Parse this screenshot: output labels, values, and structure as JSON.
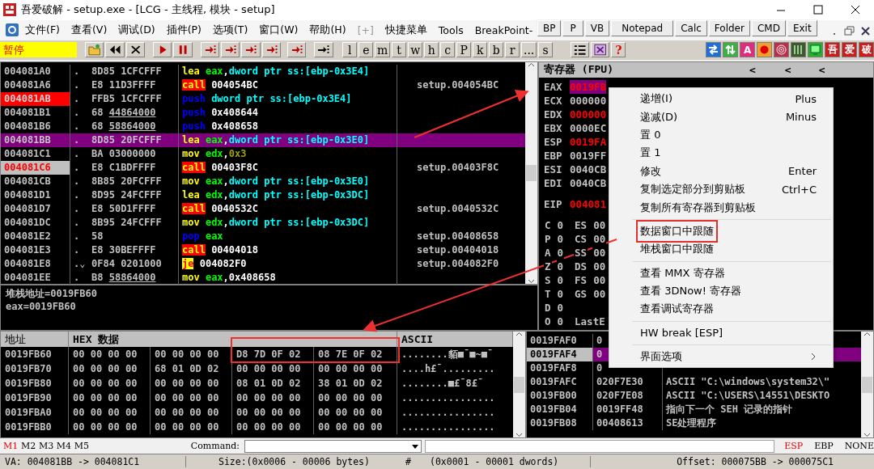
{
  "window": {
    "title": "吾爱破解 - setup.exe - [LCG - 主线程, 模块 - setup]"
  },
  "menu": [
    {
      "label": "文件(F)",
      "disabled": false
    },
    {
      "label": "查看(V)",
      "disabled": false
    },
    {
      "label": "调试(D)",
      "disabled": false
    },
    {
      "label": "插件(P)",
      "disabled": false
    },
    {
      "label": "选项(T)",
      "disabled": false
    },
    {
      "label": "窗口(W)",
      "disabled": false
    },
    {
      "label": "帮助(H)",
      "disabled": false
    },
    {
      "label": "[+]",
      "disabled": true
    },
    {
      "label": "快捷菜单",
      "disabled": false
    },
    {
      "label": "Tools",
      "disabled": false
    },
    {
      "label": "BreakPoint-",
      "disabled": false
    }
  ],
  "quick_buttons": [
    "BP",
    "P",
    "VB",
    "Notepad",
    "Calc",
    "Folder",
    "CMD",
    "Exit"
  ],
  "toolbar": {
    "status": "暂停",
    "letters": [
      "l",
      "e",
      "m",
      "t",
      "w",
      "h",
      "c",
      "P",
      "k",
      "b",
      "r",
      "...",
      "s"
    ],
    "help": "?",
    "plugins": [
      {
        "kind": "swap",
        "color": "#1f6fd6"
      },
      {
        "kind": "updown",
        "color": "#3bb143"
      },
      {
        "kind": "glyph",
        "text": "A",
        "color": "#e02c7c"
      },
      {
        "kind": "dot",
        "color": "#f0a02c"
      },
      {
        "kind": "target",
        "color": "#b8304c"
      },
      {
        "kind": "bars",
        "color": "#3d5a2c"
      },
      {
        "kind": "screen",
        "color": "#2cae2c"
      },
      {
        "kind": "glyph",
        "text": "吾",
        "color": "#c81e1e"
      },
      {
        "kind": "glyph",
        "text": "爱",
        "color": "#c81e1e"
      },
      {
        "kind": "glyph",
        "text": "破",
        "color": "#c81e1e"
      }
    ]
  },
  "disassembly": {
    "rows": [
      {
        "address": "004081A0",
        "mark": ".",
        "hex": "8D85 1CFCFFF",
        "mnemonic": "lea",
        "kind": "plain",
        "ops": [
          {
            "kind": "reg",
            "text": "eax"
          },
          {
            "kind": "sep",
            "text": ","
          },
          {
            "kind": "mem",
            "text": "dword ptr ss:[ebp-0x3E4]"
          }
        ],
        "breakpoint": false,
        "marked": false,
        "selected": false
      },
      {
        "address": "004081A6",
        "mark": ".",
        "hex": "E8 11D3FFFF",
        "mnemonic": "call",
        "kind": "call",
        "ops": [
          {
            "kind": "imm",
            "text": "004054BC"
          }
        ],
        "comment": "setup.004054BC",
        "breakpoint": false,
        "marked": false,
        "selected": false
      },
      {
        "address": "004081AB",
        "mark": ".",
        "hex": "FFB5 1CFCFFF",
        "mnemonic": "push",
        "kind": "stack",
        "ops": [
          {
            "kind": "mem",
            "text": "dword ptr ss:[ebp-0x3E4]"
          }
        ],
        "breakpoint": true,
        "marked": false,
        "selected": false
      },
      {
        "address": "004081B1",
        "mark": ".",
        "hex": "68 44864000",
        "fixup": true,
        "mnemonic": "push",
        "kind": "stack",
        "ops": [
          {
            "kind": "imm",
            "text": "0x408644"
          }
        ],
        "breakpoint": false,
        "marked": false,
        "selected": false
      },
      {
        "address": "004081B6",
        "mark": ".",
        "hex": "68 58864000",
        "fixup": true,
        "mnemonic": "push",
        "kind": "stack",
        "ops": [
          {
            "kind": "imm",
            "text": "0x408658"
          }
        ],
        "breakpoint": false,
        "marked": false,
        "selected": false
      },
      {
        "address": "004081BB",
        "mark": ".",
        "hex": "8D85 20FCFFF",
        "mnemonic": "lea",
        "kind": "plain",
        "ops": [
          {
            "kind": "reg",
            "text": "eax"
          },
          {
            "kind": "sep",
            "text": ","
          },
          {
            "kind": "mem",
            "text": "dword ptr ss:[ebp-0x3E0]"
          }
        ],
        "breakpoint": false,
        "marked": false,
        "selected": true
      },
      {
        "address": "004081C1",
        "mark": ".",
        "hex": "BA 03000000",
        "mnemonic": "mov",
        "kind": "plain",
        "ops": [
          {
            "kind": "reg",
            "text": "edx"
          },
          {
            "kind": "sep",
            "text": ","
          },
          {
            "kind": "const",
            "text": "0x3"
          }
        ],
        "breakpoint": false,
        "marked": false,
        "selected": false
      },
      {
        "address": "004081C6",
        "mark": ".",
        "hex": "E8 C1BDFFFF",
        "mnemonic": "call",
        "kind": "call",
        "ops": [
          {
            "kind": "imm",
            "text": "00403F8C"
          }
        ],
        "comment": "setup.00403F8C",
        "breakpoint": false,
        "marked": true,
        "selected": false
      },
      {
        "address": "004081CB",
        "mark": ".",
        "hex": "8B85 20FCFFF",
        "mnemonic": "mov",
        "kind": "plain",
        "ops": [
          {
            "kind": "reg",
            "text": "eax"
          },
          {
            "kind": "sep",
            "text": ","
          },
          {
            "kind": "mem",
            "text": "dword ptr ss:[ebp-0x3E0]"
          }
        ],
        "breakpoint": false,
        "marked": false,
        "selected": false
      },
      {
        "address": "004081D1",
        "mark": ".",
        "hex": "8D95 24FCFFF",
        "mnemonic": "lea",
        "kind": "plain",
        "ops": [
          {
            "kind": "reg",
            "text": "edx"
          },
          {
            "kind": "sep",
            "text": ","
          },
          {
            "kind": "mem",
            "text": "dword ptr ss:[ebp-0x3DC]"
          }
        ],
        "breakpoint": false,
        "marked": false,
        "selected": false
      },
      {
        "address": "004081D7",
        "mark": ".",
        "hex": "E8 50D1FFFF",
        "mnemonic": "call",
        "kind": "call",
        "ops": [
          {
            "kind": "imm",
            "text": "0040532C"
          }
        ],
        "comment": "setup.0040532C",
        "breakpoint": false,
        "marked": false,
        "selected": false
      },
      {
        "address": "004081DC",
        "mark": ".",
        "hex": "8B95 24FCFFF",
        "mnemonic": "mov",
        "kind": "plain",
        "ops": [
          {
            "kind": "reg",
            "text": "edx"
          },
          {
            "kind": "sep",
            "text": ","
          },
          {
            "kind": "mem",
            "text": "dword ptr ss:[ebp-0x3DC]"
          }
        ],
        "breakpoint": false,
        "marked": false,
        "selected": false
      },
      {
        "address": "004081E2",
        "mark": ".",
        "hex": "58",
        "mnemonic": "pop",
        "kind": "stack",
        "ops": [
          {
            "kind": "reg",
            "text": "eax"
          }
        ],
        "comment": "setup.00408658",
        "breakpoint": false,
        "marked": false,
        "selected": false
      },
      {
        "address": "004081E3",
        "mark": ".",
        "hex": "E8 30BEFFFF",
        "mnemonic": "call",
        "kind": "call",
        "ops": [
          {
            "kind": "imm",
            "text": "00404018"
          }
        ],
        "comment": "setup.00404018",
        "breakpoint": false,
        "marked": false,
        "selected": false
      },
      {
        "address": "004081E8",
        "mark": ".⌄",
        "hex": "0F84 0201000",
        "mnemonic": "je",
        "kind": "jump",
        "ops": [
          {
            "kind": "imm",
            "text": "004082F0"
          }
        ],
        "comment": "setup.004082F0",
        "breakpoint": false,
        "marked": false,
        "selected": false
      },
      {
        "address": "004081EE",
        "mark": ".",
        "hex": "B8 58864000",
        "fixup": true,
        "mnemonic": "mov",
        "kind": "plain",
        "ops": [
          {
            "kind": "reg",
            "text": "eax"
          },
          {
            "kind": "sep",
            "text": ","
          },
          {
            "kind": "imm",
            "text": "0x408658"
          }
        ],
        "breakpoint": false,
        "marked": false,
        "selected": false
      }
    ]
  },
  "info": [
    "堆栈地址=0019FB60",
    "eax=0019FB60"
  ],
  "registers": {
    "title": "寄存器 (FPU)",
    "nav": [
      "<",
      "<",
      "<"
    ],
    "general": [
      {
        "name": "EAX",
        "value": "0019FB",
        "changed": true,
        "selected": true
      },
      {
        "name": "ECX",
        "value": "000000",
        "changed": false,
        "selected": false
      },
      {
        "name": "EDX",
        "value": "000000",
        "changed": true,
        "selected": false
      },
      {
        "name": "EBX",
        "value": "0000EC",
        "changed": false,
        "selected": false
      },
      {
        "name": "ESP",
        "value": "0019FA",
        "changed": true,
        "selected": false
      },
      {
        "name": "EBP",
        "value": "0019FF",
        "changed": false,
        "selected": false
      },
      {
        "name": "ESI",
        "value": "0040CB",
        "changed": false,
        "selected": false
      },
      {
        "name": "EDI",
        "value": "0040CB",
        "changed": false,
        "selected": false
      }
    ],
    "eip": {
      "name": "EIP",
      "value": "004081",
      "changed": true
    },
    "flags": [
      {
        "flag": "C",
        "value": "0",
        "seg": "ES",
        "seg_value": "00"
      },
      {
        "flag": "P",
        "value": "0",
        "seg": "CS",
        "seg_value": "00"
      },
      {
        "flag": "A",
        "value": "0",
        "seg": "SS",
        "seg_value": "00"
      },
      {
        "flag": "Z",
        "value": "0",
        "seg": "DS",
        "seg_value": "00"
      },
      {
        "flag": "S",
        "value": "0",
        "seg": "FS",
        "seg_value": "00"
      },
      {
        "flag": "T",
        "value": "0",
        "seg": "GS",
        "seg_value": "00"
      },
      {
        "flag": "D",
        "value": "0"
      },
      {
        "flag": "O",
        "value": "0",
        "seg": "LastE"
      }
    ]
  },
  "context_menu": {
    "items": [
      {
        "kind": "item",
        "label": "递增(I)",
        "shortcut": "Plus"
      },
      {
        "kind": "item",
        "label": "递减(D)",
        "shortcut": "Minus"
      },
      {
        "kind": "item",
        "label": "置 0"
      },
      {
        "kind": "item",
        "label": "置 1"
      },
      {
        "kind": "item",
        "label": "修改",
        "shortcut": "Enter"
      },
      {
        "kind": "item",
        "label": "复制选定部分到剪贴板",
        "shortcut": "Ctrl+C"
      },
      {
        "kind": "item",
        "label": "复制所有寄存器到剪贴板"
      },
      {
        "kind": "separator"
      },
      {
        "kind": "item",
        "label": "数据窗口中跟随",
        "annotated": true
      },
      {
        "kind": "item",
        "label": "堆栈窗口中跟随"
      },
      {
        "kind": "separator"
      },
      {
        "kind": "item",
        "label": "查看 MMX 寄存器"
      },
      {
        "kind": "item",
        "label": "查看 3DNow! 寄存器"
      },
      {
        "kind": "item",
        "label": "查看调试寄存器"
      },
      {
        "kind": "separator"
      },
      {
        "kind": "item",
        "label": "HW break [ESP]"
      },
      {
        "kind": "separator"
      },
      {
        "kind": "submenu",
        "label": "界面选项"
      }
    ]
  },
  "dump": {
    "columns": [
      "地址",
      "HEX 数据",
      "ASCII"
    ],
    "rows": [
      {
        "address": "0019FB60",
        "bytes": [
          "00 00 00 00",
          "00 00 00 00",
          "D8 7D 0F 02",
          "08 7E 0F 02"
        ],
        "ascii": "........貊■¯■~■¯"
      },
      {
        "address": "0019FB70",
        "bytes": [
          "00 00 00 00",
          "68 01 0D 02",
          "00 00 00 00",
          "00 00 00 00"
        ],
        "ascii": "....h£¯........."
      },
      {
        "address": "0019FB80",
        "bytes": [
          "00 00 00 00",
          "00 00 00 00",
          "08 01 0D 02",
          "38 01 0D 02"
        ],
        "ascii": "........■£¯8£¯"
      },
      {
        "address": "0019FB90",
        "bytes": [
          "00 00 00 00",
          "00 00 00 00",
          "00 00 00 00",
          "00 00 00 00"
        ],
        "ascii": "................"
      },
      {
        "address": "0019FBA0",
        "bytes": [
          "00 00 00 00",
          "00 00 00 00",
          "00 00 00 00",
          "00 00 00 00"
        ],
        "ascii": "................"
      },
      {
        "address": "0019FBB0",
        "bytes": [
          "00 00 00 00",
          "00 00 00 00",
          "00 00 00 00",
          "00 00 00 00"
        ],
        "ascii": "................"
      }
    ]
  },
  "stack": {
    "rows": [
      {
        "address": "0019FAF0",
        "value": "0",
        "selected": false
      },
      {
        "address": "0019FAF4",
        "value": "0",
        "selected": true
      },
      {
        "address": "0019FAF8",
        "value": "0",
        "selected": false
      },
      {
        "address": "0019FAFC",
        "value": "020F7E30",
        "comment": "ASCII \"C:\\windows\\system32\\\"",
        "selected": false
      },
      {
        "address": "0019FB00",
        "value": "020F7E08",
        "comment": "ASCII \"C:\\USERS\\14551\\DESKTO",
        "selected": false
      },
      {
        "address": "0019FB04",
        "value": "0019FF48",
        "comment": "指向下一个 SEH 记录的指针",
        "selected": false
      },
      {
        "address": "0019FB08",
        "value": "00408613",
        "comment": "SE处理程序",
        "selected": false
      }
    ]
  },
  "command_bar": {
    "marks": [
      {
        "label": "M1",
        "selected": true
      },
      {
        "label": "M2",
        "selected": false
      },
      {
        "label": "M3",
        "selected": false
      },
      {
        "label": "M4",
        "selected": false
      },
      {
        "label": "M5",
        "selected": false
      }
    ],
    "label": "Command:",
    "bases": [
      {
        "label": "ESP",
        "selected": true
      },
      {
        "label": "EBP",
        "selected": false
      },
      {
        "label": "NONE",
        "selected": false
      }
    ]
  },
  "status_bar": {
    "va": "VA: 004081BB -> 004081C1",
    "size": "Size:(0x0006 - 00006 bytes)",
    "hash": "#",
    "dwords": "(0x0001 - 00001 dwords)",
    "offset": "Offset: 000075BB -> 000075C1"
  }
}
